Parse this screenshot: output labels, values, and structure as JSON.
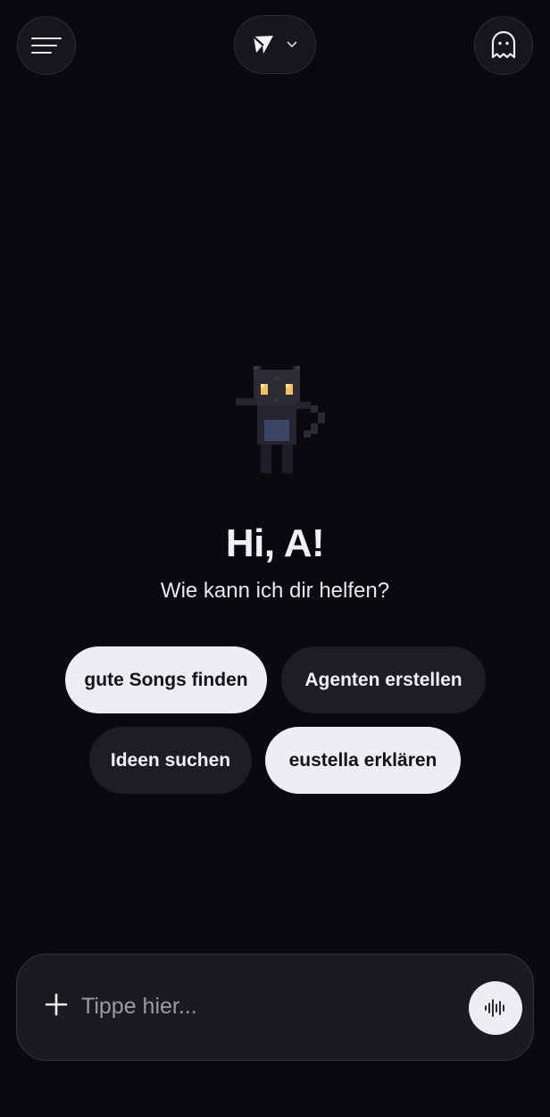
{
  "header": {
    "menu_icon": "hamburger-menu-icon",
    "model_icon": "paper-plane-logo-icon",
    "dropdown_icon": "chevron-down-icon",
    "ghost_icon": "ghost-icon"
  },
  "hero": {
    "mascot": "pixel-cat-icon",
    "greeting": "Hi, A!",
    "subtitle": "Wie kann ich dir helfen?"
  },
  "suggestions": [
    {
      "label": "gute Songs finden",
      "style": "light"
    },
    {
      "label": "Agenten erstellen",
      "style": "dark"
    },
    {
      "label": "Ideen suchen",
      "style": "dark"
    },
    {
      "label": "eustella erklären",
      "style": "light"
    }
  ],
  "composer": {
    "placeholder": "Tippe hier...",
    "value": "",
    "add_icon": "plus-icon",
    "voice_icon": "audio-waveform-icon"
  },
  "colors": {
    "background": "#0a090f",
    "surface": "#17161c",
    "chip_light": "#eeedf2",
    "chip_dark": "#1e1d22",
    "text": "#f2f2f5"
  }
}
